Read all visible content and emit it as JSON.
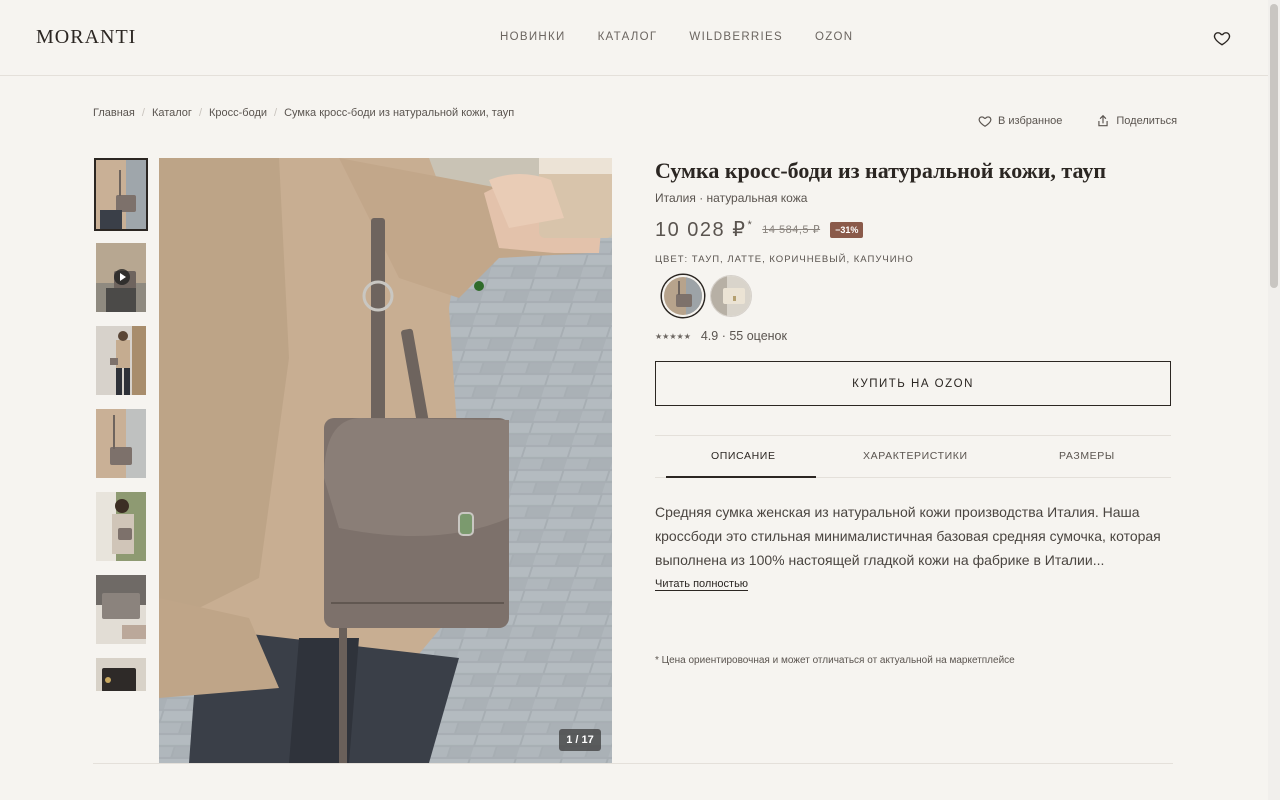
{
  "brand": "MORANTI",
  "nav": [
    "НОВИНКИ",
    "КАТАЛОГ",
    "WILDBERRIES",
    "OZON"
  ],
  "breadcrumb": [
    "Главная",
    "Каталог",
    "Кросс-боди",
    "Сумка кросс-боди из натуральной кожи, тауп"
  ],
  "actions": {
    "favorite": "В избранное",
    "share": "Поделиться"
  },
  "gallery": {
    "counter": "1 / 17",
    "thumb_count": 7
  },
  "product": {
    "title": "Сумка кросс-боди из натуральной кожи, тауп",
    "subtitle": "Италия · натуральная кожа",
    "price": "10 028 ₽",
    "price_mark": "*",
    "old_price": "14 584,5 ₽",
    "discount": "−31%",
    "colors_label": "ЦВЕТ: ТАУП, ЛАТТЕ, КОРИЧНЕВЫЙ, КАПУЧИНО",
    "stars": "★★★★★",
    "rating": "4.9 · 55 оценок",
    "buy_label": "КУПИТЬ НА OZON"
  },
  "tabs": [
    "ОПИСАНИЕ",
    "ХАРАКТЕРИСТИКИ",
    "РАЗМЕРЫ"
  ],
  "description": "Средняя сумка женская из натуральной кожи производства Италия. Наша кроссбоди это стильная минималистичная базовая средняя сумочка, которая выполнена из 100% настоящей гладкой кожи на фабрике в Италии...",
  "read_more": "Читать полностью",
  "note": "* Цена ориентировочная и может отличаться от актуальной на маркетплейсе",
  "colors": {
    "bag": "#7d716b",
    "coat": "#c8ae92",
    "accent_badge": "#8a5a4a"
  }
}
